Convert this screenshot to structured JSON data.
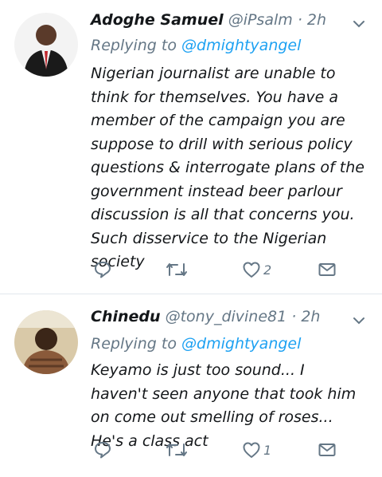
{
  "tweets": [
    {
      "name": "Adoghe Samuel",
      "handle": "@iPsalm",
      "time": "· 2h",
      "replying_prefix": "Replying to",
      "replying_to": "@dmightyangel",
      "text": "Nigerian journalist are unable to think for themselves. You have a member of the campaign you are suppose to drill with serious policy questions & interrogate plans of the government instead beer parlour discussion is all that concerns you. Such disservice to the Nigerian society",
      "likes": "2"
    },
    {
      "name": "Chinedu",
      "handle": "@tony_divine81",
      "time": "· 2h",
      "replying_prefix": "Replying to",
      "replying_to": "@dmightyangel",
      "text": "Keyamo is just too sound... I haven't seen anyone that took him on come out smelling of roses... He's a class act",
      "likes": "1"
    }
  ],
  "colors": {
    "accent": "#1da1f2",
    "muted": "#657786",
    "divider": "#e1e8ed"
  },
  "icons": [
    "chevron-down-icon",
    "reply-icon",
    "retweet-icon",
    "like-icon",
    "message-icon"
  ]
}
